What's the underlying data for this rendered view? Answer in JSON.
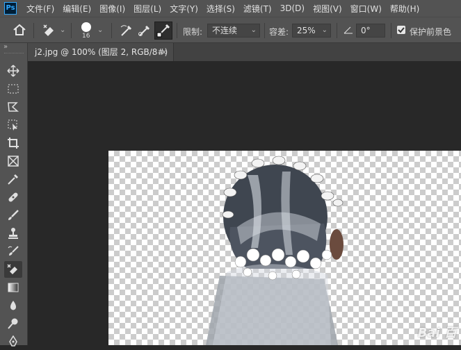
{
  "app": {
    "logo_text": "Ps"
  },
  "menu": [
    "文件(F)",
    "编辑(E)",
    "图像(I)",
    "图层(L)",
    "文字(Y)",
    "选择(S)",
    "滤镜(T)",
    "3D(D)",
    "视图(V)",
    "窗口(W)",
    "帮助(H)"
  ],
  "options": {
    "brush_size": "16",
    "limit_label": "限制:",
    "limit_value": "不连续",
    "tolerance_label": "容差:",
    "tolerance_value": "25%",
    "angle_value": "0°",
    "protect_fg_label": "保护前景色",
    "protect_fg_checked": true
  },
  "tab": {
    "title": "j2.jpg @ 100% (图层 2, RGB/8#) *",
    "close": "×"
  },
  "toolbar": {
    "collapse": "»",
    "tools": [
      "move",
      "marquee",
      "lasso",
      "object-select",
      "crop",
      "frame",
      "eyedropper",
      "healing",
      "brush",
      "stamp",
      "history-brush",
      "background-eraser",
      "gradient",
      "blur",
      "dodge",
      "pen"
    ],
    "active_tool": "background-eraser"
  },
  "canvas": {
    "watermark": "Bai 百"
  }
}
